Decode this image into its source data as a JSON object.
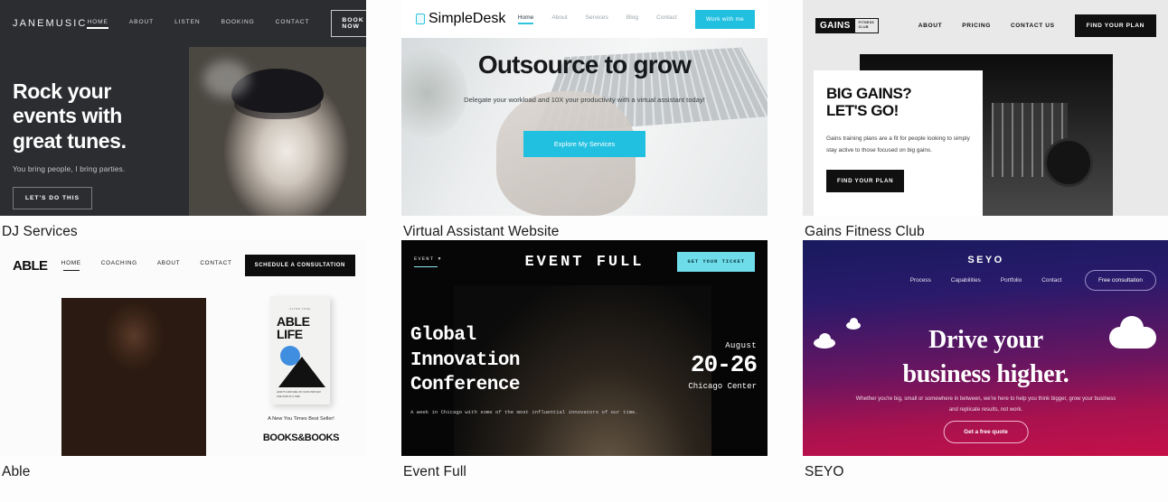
{
  "gallery": {
    "items": [
      {
        "caption": "DJ Services",
        "site": {
          "logo": "JANEMUSIC",
          "nav": [
            "HOME",
            "ABOUT",
            "LISTEN",
            "BOOKING",
            "CONTACT"
          ],
          "nav_button": "BOOK NOW",
          "heading": "Rock your events with great tunes.",
          "subheading": "You bring people, I bring parties.",
          "cta": "LET'S DO THIS"
        }
      },
      {
        "caption": "Virtual Assistant Website",
        "site": {
          "logo": "SimpleDesk",
          "nav": [
            "Home",
            "About",
            "Services",
            "Blog",
            "Contact"
          ],
          "nav_button": "Work with me",
          "heading": "Outsource to grow",
          "subheading": "Delegate your workload and 10X your productivity with a virtual assistant today!",
          "cta": "Explore My Services"
        }
      },
      {
        "caption": "Gains Fitness Club",
        "site": {
          "logo": "GAINS",
          "logo_sub_line1": "FITNESS",
          "logo_sub_line2": "CLUB",
          "nav": [
            "ABOUT",
            "PRICING",
            "CONTACT US"
          ],
          "nav_button": "FIND YOUR PLAN",
          "heading_line1": "BIG GAINS?",
          "heading_line2": "LET'S GO!",
          "body": "Gains training plans are a fit for people looking to simply stay active to those focused on big gains.",
          "cta": "FIND YOUR PLAN"
        }
      },
      {
        "caption": "Able",
        "site": {
          "logo": "ABLE",
          "nav": [
            "HOME",
            "COACHING",
            "ABOUT",
            "CONTACT"
          ],
          "nav_button": "SCHEDULE A CONSULTATION",
          "book_kicker": "FLYNN JOSE",
          "book_title_line1": "ABLE",
          "book_title_line2": "LIFE",
          "book_blurb": "HOW TO ADD SIZE ON YOUR OWN WAY ONE STEP AT A TIME",
          "seller_note": "A New You Times Best Seller!",
          "bookstore": "BOOKS&BOOKS"
        }
      },
      {
        "caption": "Event Full",
        "site": {
          "dropdown": "EVENT",
          "title": "EVENT FULL",
          "nav_button": "GET YOUR TICKET",
          "heading_line1": "Global",
          "heading_line2": "Innovation",
          "heading_line3": "Conference",
          "body": "A week in Chicago with some of the most influential innovators of our time.",
          "month": "August",
          "days": "20-26",
          "venue": "Chicago Center"
        }
      },
      {
        "caption": "SEYO",
        "site": {
          "logo": "SEYO",
          "nav": [
            "Process",
            "Capabilities",
            "Portfolio",
            "Contact"
          ],
          "nav_button": "Free consultation",
          "heading_line1": "Drive your",
          "heading_line2": "business higher.",
          "body": "Whether you're big, small or somewhere in between, we're here to help you think bigger, grow your business and replicate results, not work.",
          "cta": "Get a free quote"
        }
      }
    ]
  },
  "colors": {
    "page_bg": "#fdfdfd",
    "dj_bg": "#2b2d30",
    "simpledesk_accent": "#22c0e0",
    "gains_bg": "#e9e9e9",
    "eventfull_accent": "#6fdcea",
    "seyo_gradient_start": "#181a5e",
    "seyo_gradient_end": "#c51048"
  }
}
